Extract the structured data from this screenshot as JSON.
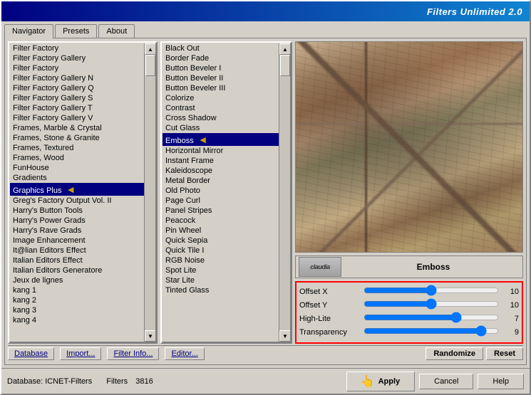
{
  "window": {
    "title": "Filters Unlimited 2.0"
  },
  "tabs": [
    {
      "label": "Navigator",
      "active": true
    },
    {
      "label": "Presets"
    },
    {
      "label": "About"
    }
  ],
  "left_list": {
    "items": [
      "Filter Factory",
      "Filter Factory Gallery",
      "Filter Factory",
      "Filter Factory Gallery N",
      "Filter Factory Gallery Q",
      "Filter Factory Gallery S",
      "Filter Factory Gallery T",
      "Filter Factory Gallery V",
      "Frames, Marble & Crystal",
      "Frames, Stone & Granite",
      "Frames, Textured",
      "Frames, Wood",
      "FunHouse",
      "Gradients",
      "Graphics Plus",
      "Greg's Factory Output Vol. II",
      "Harry's Button Tools",
      "Harry's Power Grads",
      "Harry's Rave Grads",
      "Image Enhancement",
      "It@lian Editors Effect",
      "Italian Editors Effect",
      "Italian Editors Generatore",
      "Jeux de lignes",
      "kang 1",
      "kang 2",
      "kang 3",
      "kang 4"
    ],
    "selected_index": 14
  },
  "middle_list": {
    "items": [
      "Black Out",
      "Border Fade",
      "Button Beveler I",
      "Button Beveler II",
      "Button Beveler III",
      "Colorize",
      "Contrast",
      "Cross Shadow",
      "Cut Glass",
      "Emboss",
      "Horizontal Mirror",
      "Instant Frame",
      "Kaleidoscope",
      "Metal Border",
      "Old Photo",
      "Page Curl",
      "Panel Stripes",
      "Peacock",
      "Pin Wheel",
      "Quick Sepia",
      "Quick Tile I",
      "RGB Noise",
      "Spot Lite",
      "Star Lite",
      "Tinted Glass"
    ],
    "selected_index": 9,
    "selected_item": "Emboss"
  },
  "filter_name": "Emboss",
  "params": [
    {
      "label": "Offset X",
      "value": 10,
      "max": 20
    },
    {
      "label": "Offset Y",
      "value": 10,
      "max": 20
    },
    {
      "label": "High-Lite",
      "value": 7,
      "max": 10
    },
    {
      "label": "Transparency",
      "value": 9,
      "max": 10
    }
  ],
  "toolbar_buttons": {
    "database": "Database",
    "import": "Import...",
    "filter_info": "Filter Info...",
    "editor": "Editor...",
    "randomize": "Randomize",
    "reset": "Reset"
  },
  "status": {
    "database_label": "Database:",
    "database_value": "ICNET-Filters",
    "filters_label": "Filters",
    "filters_value": "3816"
  },
  "action_buttons": {
    "apply": "Apply",
    "cancel": "Cancel",
    "help": "Help"
  }
}
